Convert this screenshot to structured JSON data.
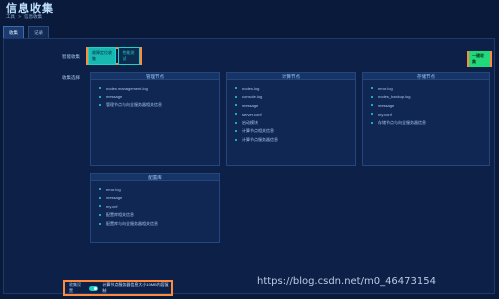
{
  "header": {
    "title": "信息收集",
    "breadcrumb": [
      "工具",
      ">",
      "信息收集"
    ]
  },
  "tabs": [
    {
      "label": "收集",
      "active": true
    },
    {
      "label": "记录",
      "active": false
    }
  ],
  "form": {
    "mode_label": "智能收集",
    "mode_options": [
      {
        "label": "故障定位收集",
        "active": true
      },
      {
        "label": "性能测试",
        "active": false
      }
    ],
    "collect_button": "一键收集",
    "items_label": "收集选择",
    "setting_label": "收集设置",
    "setting_text": "计算节点服务器信息大小10MB内容复制"
  },
  "cards": [
    {
      "title": "管理节点",
      "items": [
        "nodes management.log",
        "message",
        "管理节点与向全服务器相关信息"
      ]
    },
    {
      "title": "计算节点",
      "items": [
        "nodes.log",
        "console.log",
        "message",
        "server.conf",
        "启动模块",
        "计算节点相关信息",
        "计算节点服务器信息"
      ]
    },
    {
      "title": "存储节点",
      "items": [
        "error.log",
        "nodes_backup.log",
        "message",
        "my.conf",
        "存储节点与向全服务器信息"
      ]
    },
    {
      "title": "配置库",
      "items": [
        "error.log",
        "message",
        "my.cnf",
        "配置库相关信息",
        "配置库与向全服务器相关信息"
      ]
    }
  ],
  "watermark": "https://blog.csdn.net/m0_46473154",
  "colors": {
    "background": "#0a1a3a",
    "accent": "#1fd0c8",
    "highlight": "#ff8a3d",
    "button": "#21d87a"
  }
}
